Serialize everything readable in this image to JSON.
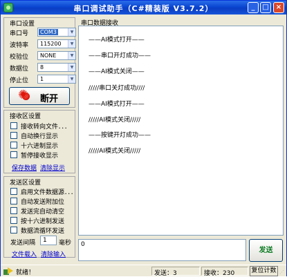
{
  "window": {
    "title": "串口调试助手（C#精装版 V3.7.2）",
    "minimize": "_",
    "maximize": "□",
    "close": "×"
  },
  "port_settings": {
    "title": "串口设置",
    "fields": [
      {
        "label": "串口号",
        "value": "COM3"
      },
      {
        "label": "波特率",
        "value": "115200"
      },
      {
        "label": "校验位",
        "value": "NONE"
      },
      {
        "label": "数据位",
        "value": "8"
      },
      {
        "label": "停止位",
        "value": "1"
      }
    ],
    "connect_button": "断开",
    "led_color": "#e0150a"
  },
  "receive_settings": {
    "title": "接收区设置",
    "options": [
      "接收转向文件．．．",
      "自动换行显示",
      "十六进制显示",
      "暂停接收显示"
    ],
    "save_link": "保存数据",
    "clear_link": "清除显示"
  },
  "send_settings": {
    "title": "发送区设置",
    "options": [
      "启用文件数据源．．．",
      "自动发送附加位",
      "发送完自动清空",
      "按十六进制发送",
      "数据流循环发送"
    ],
    "interval_label": "发送间隔",
    "interval_value": "1",
    "interval_unit": "毫秒",
    "file_link": "文件载入",
    "clear_link": "清除输入"
  },
  "receive_area": {
    "title": "串口数据接收",
    "lines": [
      "——AI模式打开——",
      "——串口开灯成功——",
      "——AI模式关闭——",
      "/////串口关灯成功////",
      "——AI模式打开——",
      "/////AI模式关闭/////",
      "——按键开灯成功——",
      "/////AI模式关闭/////"
    ]
  },
  "send_area": {
    "value": "0",
    "send_button": "发送"
  },
  "status_bar": {
    "status": "就绪！",
    "sent_label": "发送：3",
    "received_label": "接收：230",
    "reset_button": "复位计数"
  }
}
